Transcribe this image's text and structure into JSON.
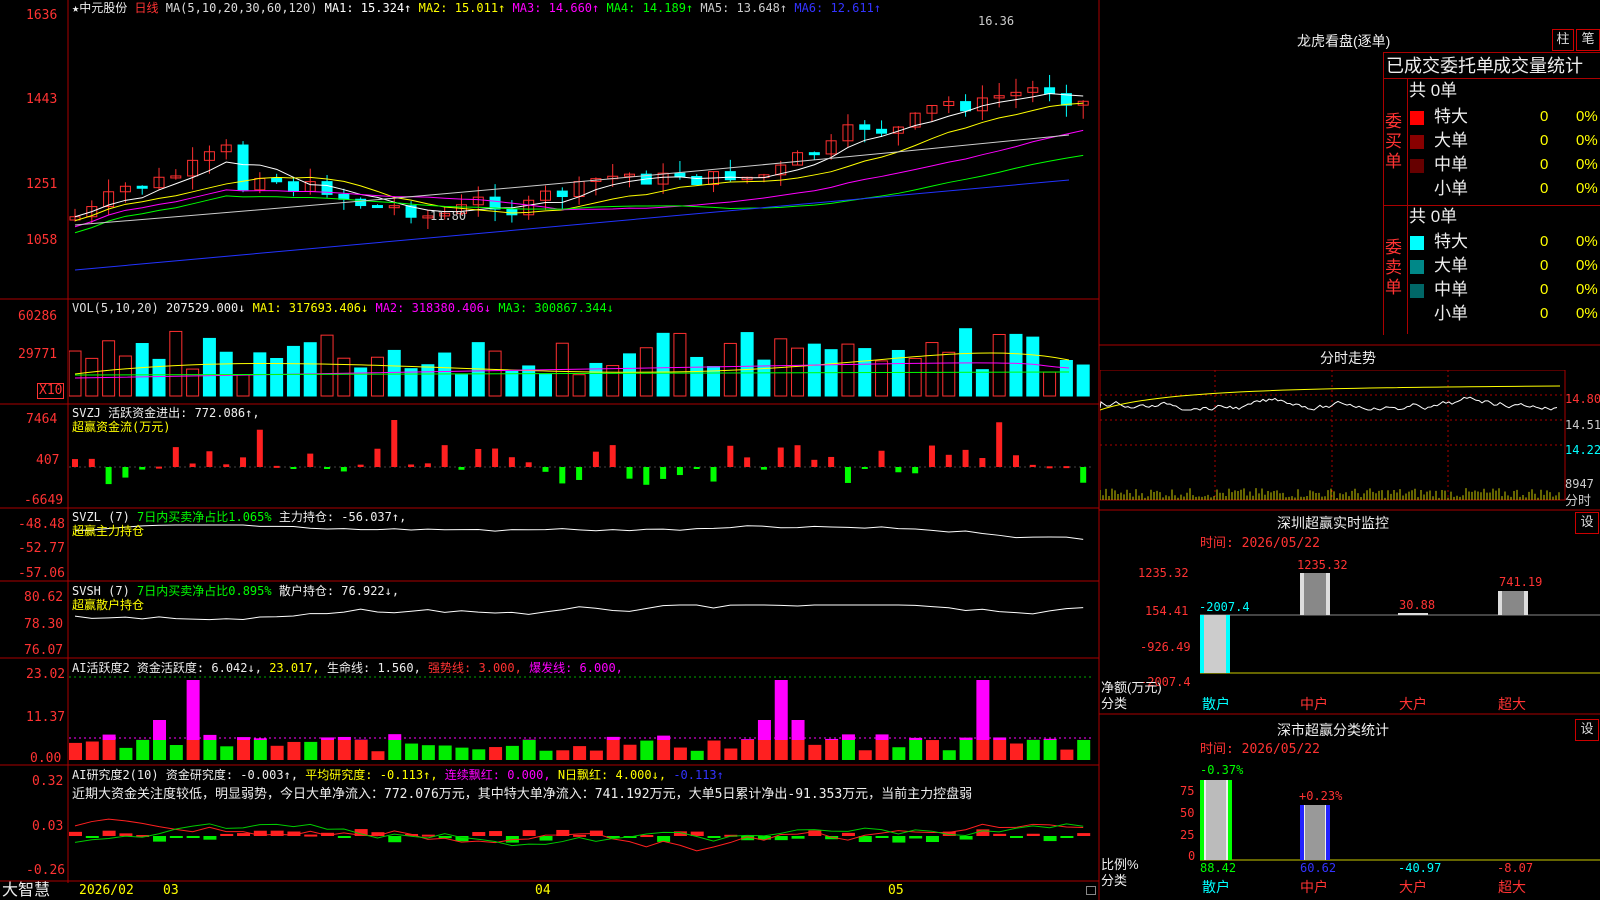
{
  "header": {
    "stock": "★中元股份",
    "period": "日线",
    "ma_def": "MA(5,10,20,30,60,120)",
    "ma": [
      {
        "label": "MA1: 15.324↑",
        "color": "#ffffff"
      },
      {
        "label": "MA2: 15.011↑",
        "color": "#ffff00"
      },
      {
        "label": "MA3: 14.660↑",
        "color": "#ff00ff"
      },
      {
        "label": "MA4: 14.189↑",
        "color": "#00ff00"
      },
      {
        "label": "MA5: 13.648↑",
        "color": "#cccccc"
      },
      {
        "label": "MA6: 12.611↑",
        "color": "#2222ff"
      }
    ],
    "high_marker": "16.36",
    "low_marker": "11.80"
  },
  "price_axis": [
    "1636",
    "1443",
    "1251",
    "1058"
  ],
  "vol": {
    "def": "VOL(5,10,20)",
    "value": "207529.000↓",
    "ma1": "MA1: 317693.406↓",
    "ma2": "MA2: 318380.406↓",
    "ma3": "MA3: 300867.344↓",
    "axis": [
      "60286",
      "29771"
    ],
    "unit": "X10"
  },
  "svzj": {
    "title": "SVZJ  活跃资金进出: 772.086↑,",
    "subtitle": "超赢资金流(万元)",
    "axis": [
      "7464",
      "407",
      "-6649"
    ]
  },
  "svzl": {
    "title": "SVZL (7)",
    "ratio": "7日内买卖净占比1.065%",
    "hold": "主力持仓: -56.037↑,",
    "subtitle": "超赢主力持仓",
    "axis": [
      "-48.48",
      "-52.77",
      "-57.06"
    ]
  },
  "svsh": {
    "title": "SVSH (7)",
    "ratio": "7日内买卖净占比0.895%",
    "hold": "散户持仓: 76.922↓,",
    "subtitle": "超赢散户持仓",
    "axis": [
      "80.62",
      "78.30",
      "76.07"
    ]
  },
  "ai_active": {
    "title": "AI活跃度2",
    "act": "资金活跃度: 6.042↓,",
    "v2": "23.017,",
    "life": "生命线: 1.560,",
    "strong": "强势线: 3.000,",
    "burst": "爆发线: 6.000,",
    "axis": [
      "23.02",
      "11.37",
      "0.00"
    ]
  },
  "ai_research": {
    "title": "AI研究度2(10)",
    "res": "资金研究度: -0.003↑,",
    "avg": "平均研究度: -0.113↑,",
    "red": "连续飘红: 0.000,",
    "nred": "N日飘红: 4.000↓,",
    "last": "-0.113↑",
    "comment": "近期大资金关注度较低，明显弱势，今日大单净流入：772.076万元，其中特大单净流入：741.192万元，大单5日累计净出-91.353万元，当前主力控盘弱",
    "axis": [
      "0.32",
      "0.03",
      "-0.26"
    ]
  },
  "bottom": {
    "brand": "大智慧",
    "dates": [
      "2026/02",
      "03",
      "04",
      "05"
    ]
  },
  "dragon": {
    "title": "龙虎看盘(逐单)",
    "btn1": "柱",
    "btn2": "笔",
    "tabs": [
      "已成交委托单",
      "成交量统计"
    ],
    "buy_total": "共 0单",
    "sell_total": "共 0单",
    "buy_label": "委买单",
    "sell_label": "委卖单",
    "buy_rows": [
      {
        "name": "特大",
        "n": "0",
        "p": "0%",
        "color": "#ff0000"
      },
      {
        "name": "大单",
        "n": "0",
        "p": "0%",
        "color": "#880000"
      },
      {
        "name": "中单",
        "n": "0",
        "p": "0%",
        "color": "#660000"
      },
      {
        "name": "小单",
        "n": "0",
        "p": "0%",
        "color": "#000000"
      }
    ],
    "sell_rows": [
      {
        "name": "特大",
        "n": "0",
        "p": "0%",
        "color": "#00ffff"
      },
      {
        "name": "大单",
        "n": "0",
        "p": "0%",
        "color": "#008888"
      },
      {
        "name": "中单",
        "n": "0",
        "p": "0%",
        "color": "#006666"
      },
      {
        "name": "小单",
        "n": "0",
        "p": "0%",
        "color": "#000000"
      }
    ]
  },
  "intraday": {
    "title": "分时走势",
    "axis": [
      "14.80",
      "14.51",
      "14.22",
      "8947"
    ],
    "unit": "分时"
  },
  "realtime": {
    "title": "深圳超赢实时监控",
    "btn": "设",
    "time": "时间: 2026/05/22",
    "axis": [
      "1235.32",
      "154.41",
      "-926.49",
      "-2007.4"
    ],
    "y_label": "净额(万元)",
    "x_label": "分类",
    "cats": [
      "散户",
      "中户",
      "大户",
      "超大"
    ],
    "values": [
      "-2007.4",
      "1235.32",
      "30.88",
      "741.19"
    ]
  },
  "classify": {
    "title": "深市超赢分类统计",
    "btn": "设",
    "time": "时间: 2026/05/22",
    "axis": [
      "75",
      "50",
      "25",
      "0"
    ],
    "y_label": "比例%",
    "x_label": "分类",
    "cats": [
      "散户",
      "中户",
      "大户",
      "超大"
    ],
    "top_labels": [
      "-0.37%",
      "+0.23%"
    ],
    "values": [
      "88.42",
      "60.62",
      "-40.97",
      "-8.07"
    ]
  }
}
